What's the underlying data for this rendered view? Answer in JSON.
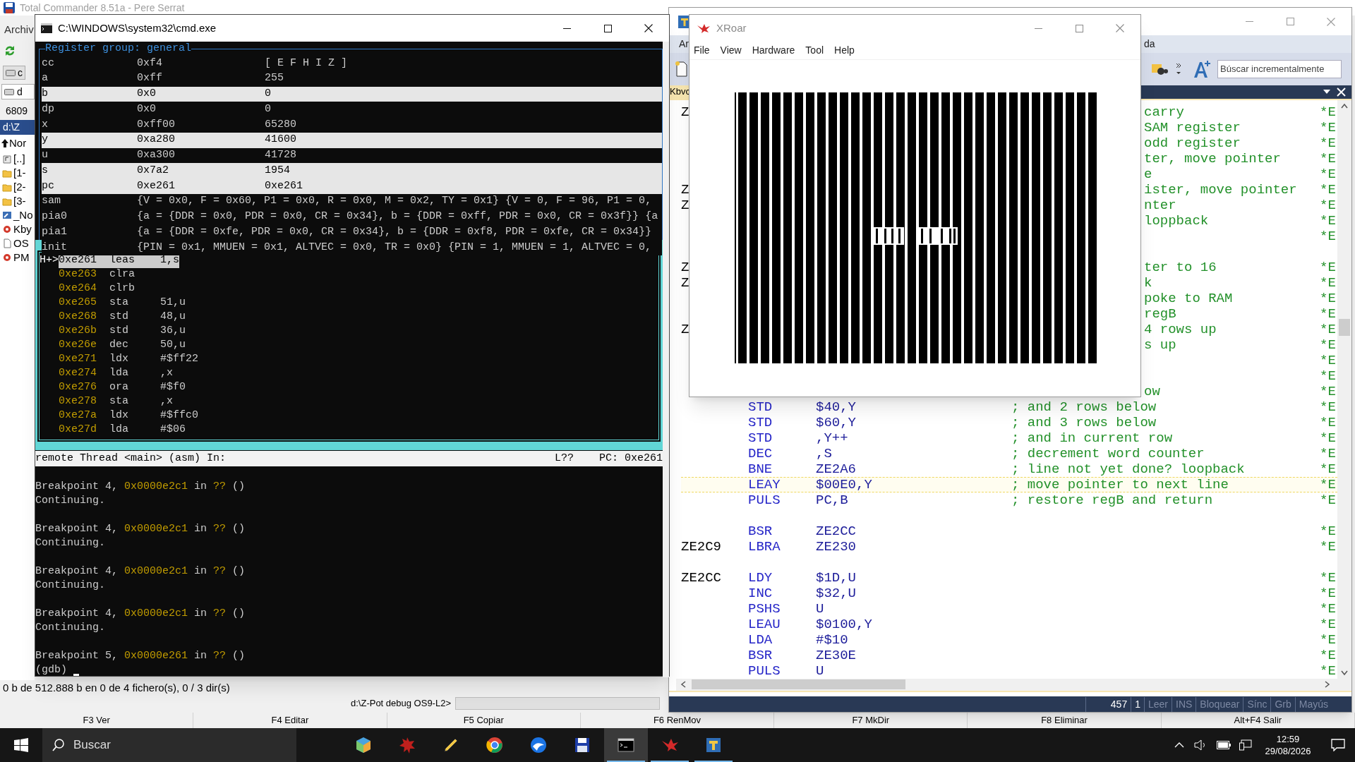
{
  "total_commander": {
    "title": "Total Commander 8.51a - Pere Serrat",
    "left_items": [
      {
        "kind": "menu",
        "text": "Archiv"
      },
      {
        "kind": "drive",
        "text": "c"
      },
      {
        "kind": "combo",
        "text": "d"
      },
      {
        "kind": "label",
        "text": "6809"
      },
      {
        "kind": "path",
        "text": "d:\\Z"
      },
      {
        "kind": "header",
        "text": "Nor"
      },
      {
        "kind": "parent",
        "text": "[..]"
      },
      {
        "kind": "folder",
        "text": "[1-"
      },
      {
        "kind": "folder",
        "text": "[2-"
      },
      {
        "kind": "folder",
        "text": "[3-"
      },
      {
        "kind": "shortcut",
        "text": "_No"
      },
      {
        "kind": "app",
        "text": "Kby"
      },
      {
        "kind": "file",
        "text": "OS"
      },
      {
        "kind": "app",
        "text": "PM"
      }
    ],
    "status": "0 b de 512.888 b en 0 de 4 fichero(s), 0 / 3 dir(s)",
    "command_prompt": "d:\\Z-Pot debug OS9-L2>",
    "function_keys": [
      "F3 Ver",
      "F4 Editar",
      "F5 Copiar",
      "F6 RenMov",
      "F7 MkDir",
      "F8 Eliminar",
      "Alt+F4 Salir"
    ]
  },
  "editor": {
    "menu_fragments": [
      "Ar",
      "da"
    ],
    "search": {
      "placeholder": "Búscar incrementalmente"
    },
    "tab": "Kbvc",
    "lines": [
      {
        "label": "Z",
        "fragment": "carry",
        "mark": "*E",
        "highlighted": false
      },
      {
        "fragment": "SAM register",
        "mark": "*E",
        "highlighted": false
      },
      {
        "fragment": "odd register",
        "mark": "*E",
        "highlighted": false
      },
      {
        "fragment": "ter, move pointer",
        "mark": "*E",
        "highlighted": false
      },
      {
        "fragment": "e",
        "mark": "*E",
        "highlighted": false
      },
      {
        "label": "Z",
        "fragment": "ister, move pointer",
        "mark": "*E",
        "highlighted": false
      },
      {
        "label": "Z",
        "fragment": "nter",
        "mark": "*E",
        "highlighted": false
      },
      {
        "fragment": "loppback",
        "mark": "*E",
        "highlighted": false
      },
      {
        "mark": "*E",
        "highlighted": false
      },
      {
        "highlighted": false
      },
      {
        "label": "Z",
        "fragment": "ter to 16",
        "mark": "*E",
        "highlighted": false
      },
      {
        "label": "Z",
        "fragment": "k",
        "mark": "*E",
        "highlighted": false
      },
      {
        "fragment": "poke to RAM",
        "mark": "*E",
        "highlighted": false
      },
      {
        "fragment": "regB",
        "mark": "*E",
        "highlighted": false
      },
      {
        "label": "Z",
        "fragment": "4 rows up",
        "mark": "*E",
        "highlighted": false
      },
      {
        "fragment": "s up",
        "mark": "*E",
        "highlighted": false
      },
      {
        "mark": "*E",
        "highlighted": false
      },
      {
        "mark": "*E",
        "highlighted": false
      },
      {
        "fragment": "ow",
        "mark": "*E",
        "highlighted": false
      },
      {
        "op": "STD",
        "operand": "$40,Y",
        "comment": "; and 2 rows below",
        "mark": "*E",
        "highlighted": false
      },
      {
        "op": "STD",
        "operand": "$60,Y",
        "comment": "; and 3 rows below",
        "mark": "*E",
        "highlighted": false
      },
      {
        "op": "STD",
        "operand": ",Y++",
        "comment": "; and in current row",
        "mark": "*E",
        "highlighted": false
      },
      {
        "op": "DEC",
        "operand": ",S",
        "comment": "; decrement word counter",
        "mark": "*E",
        "highlighted": false
      },
      {
        "op": "BNE",
        "operand": "ZE2A6",
        "comment": "; line not yet done? loopback",
        "mark": "*E",
        "highlighted": false
      },
      {
        "op": "LEAY",
        "operand": "$00E0,Y",
        "comment": "; move pointer to next line",
        "mark": "*E",
        "highlighted": true
      },
      {
        "op": "PULS",
        "operand": "PC,B",
        "comment": "; restore regB and return",
        "mark": "*E",
        "highlighted": false
      },
      {
        "highlighted": false
      },
      {
        "op": "BSR",
        "operand": "ZE2CC",
        "mark": "*E",
        "highlighted": false
      },
      {
        "label": "ZE2C9",
        "op": "LBRA",
        "operand": "ZE230",
        "mark": "*E",
        "highlighted": false
      },
      {
        "highlighted": false
      },
      {
        "label": "ZE2CC",
        "op": "LDY",
        "operand": "$1D,U",
        "mark": "*E",
        "highlighted": false
      },
      {
        "op": "INC",
        "operand": "$32,U",
        "mark": "*E",
        "highlighted": false
      },
      {
        "op": "PSHS",
        "operand": "U",
        "mark": "*E",
        "highlighted": false
      },
      {
        "op": "LEAU",
        "operand": "$0100,Y",
        "mark": "*E",
        "highlighted": false
      },
      {
        "op": "LDA",
        "operand": "#$10",
        "mark": "*E",
        "highlighted": false
      },
      {
        "op": "BSR",
        "operand": "ZE30E",
        "mark": "*E",
        "highlighted": false
      },
      {
        "op": "PULS",
        "operand": "U",
        "mark": "*E",
        "highlighted": false
      }
    ],
    "status_bar": [
      {
        "text": "457",
        "enabled": true
      },
      {
        "text": "1",
        "enabled": true
      },
      {
        "text": "Leer",
        "enabled": false
      },
      {
        "text": "INS",
        "enabled": false
      },
      {
        "text": "Bloquear",
        "enabled": false
      },
      {
        "text": "Sínc",
        "enabled": false
      },
      {
        "text": "Grb",
        "enabled": false
      },
      {
        "text": "Mayús",
        "enabled": false
      }
    ]
  },
  "console": {
    "title": "C:\\WINDOWS\\system32\\cmd.exe",
    "register_group": "Register group: general",
    "registers": [
      {
        "name": "cc",
        "hex": "0xf4",
        "natural": "[ E F H I Z ]",
        "changed": false
      },
      {
        "name": "a",
        "hex": "0xff",
        "natural": "255",
        "changed": false
      },
      {
        "name": "b",
        "hex": "0x0",
        "natural": "0",
        "changed": true
      },
      {
        "name": "dp",
        "hex": "0x0",
        "natural": "0",
        "changed": false
      },
      {
        "name": "x",
        "hex": "0xff00",
        "natural": "65280",
        "changed": false
      },
      {
        "name": "y",
        "hex": "0xa280",
        "natural": "41600",
        "changed": true
      },
      {
        "name": "u",
        "hex": "0xa300",
        "natural": "41728",
        "changed": false
      },
      {
        "name": "s",
        "hex": "0x7a2",
        "natural": "1954",
        "changed": true
      },
      {
        "name": "pc",
        "hex": "0xe261",
        "natural": "0xe261",
        "changed": true
      },
      {
        "name": "sam",
        "hex": "{V = 0x0, F = 0x60, P1 = 0x0, R = 0x0, M = 0x2, TY = 0x1}",
        "natural": "{V = 0, F = 96, P1 = 0,",
        "changed": false
      },
      {
        "name": "pia0",
        "hex": "{a = {DDR = 0x0, PDR = 0x0, CR = 0x34}, b = {DDR = 0xff, PDR = 0x0, CR = 0x3f}}",
        "natural": "{a",
        "changed": false
      },
      {
        "name": "pia1",
        "hex": "{a = {DDR = 0xfe, PDR = 0x0, CR = 0x34}, b = {DDR = 0xf8, PDR = 0xfe, CR = 0x34}}",
        "changed": false
      },
      {
        "name": "init",
        "hex": "{PIN = 0x1, MMUEN = 0x1, ALTVEC = 0x0, TR = 0x0}",
        "natural": "{PIN = 1, MMUEN = 1, ALTVEC = 0,",
        "changed": false
      }
    ],
    "disassembly": [
      {
        "marker": "H+>",
        "address": "0xe261",
        "mnemonic": "leas",
        "operand": "1,s",
        "current": true
      },
      {
        "address": "0xe263",
        "mnemonic": "clra",
        "current": false
      },
      {
        "address": "0xe264",
        "mnemonic": "clrb",
        "current": false
      },
      {
        "address": "0xe265",
        "mnemonic": "sta",
        "operand": "51,u",
        "current": false
      },
      {
        "address": "0xe268",
        "mnemonic": "std",
        "operand": "48,u",
        "current": false
      },
      {
        "address": "0xe26b",
        "mnemonic": "std",
        "operand": "36,u",
        "current": false
      },
      {
        "address": "0xe26e",
        "mnemonic": "dec",
        "operand": "50,u",
        "current": false
      },
      {
        "address": "0xe271",
        "mnemonic": "ldx",
        "operand": "#$ff22",
        "current": false
      },
      {
        "address": "0xe274",
        "mnemonic": "lda",
        "operand": ",x",
        "current": false
      },
      {
        "address": "0xe276",
        "mnemonic": "ora",
        "operand": "#$f0",
        "current": false
      },
      {
        "address": "0xe278",
        "mnemonic": "sta",
        "operand": ",x",
        "current": false
      },
      {
        "address": "0xe27a",
        "mnemonic": "ldx",
        "operand": "#$ffc0",
        "current": false
      },
      {
        "address": "0xe27d",
        "mnemonic": "lda",
        "operand": "#$06",
        "current": false
      }
    ],
    "status": {
      "thread": "remote Thread <main> (asm) In:",
      "line": "L??",
      "pc": "PC: 0xe261"
    },
    "log": [
      {
        "kind": "breakpoint",
        "text": "Breakpoint 4,",
        "address": "0x0000e2c1",
        "word": "in",
        "location": "??",
        "args": "()"
      },
      {
        "kind": "message",
        "text": "Continuing."
      },
      {
        "kind": "breakpoint",
        "text": "Breakpoint 4,",
        "address": "0x0000e2c1",
        "word": "in",
        "location": "??",
        "args": "()"
      },
      {
        "kind": "message",
        "text": "Continuing."
      },
      {
        "kind": "breakpoint",
        "text": "Breakpoint 4,",
        "address": "0x0000e2c1",
        "word": "in",
        "location": "??",
        "args": "()"
      },
      {
        "kind": "message",
        "text": "Continuing."
      },
      {
        "kind": "breakpoint",
        "text": "Breakpoint 4,",
        "address": "0x0000e2c1",
        "word": "in",
        "location": "??",
        "args": "()"
      },
      {
        "kind": "message",
        "text": "Continuing."
      },
      {
        "kind": "breakpoint",
        "text": "Breakpoint 5,",
        "address": "0x0000e261",
        "word": "in",
        "location": "??",
        "args": "()"
      }
    ],
    "prompt": "(gdb)"
  },
  "xroar": {
    "title": "XRoar",
    "menu": [
      "File",
      "View",
      "Hardware",
      "Tool",
      "Help"
    ]
  },
  "taskbar": {
    "search": {
      "placeholder": "Buscar"
    },
    "apps": [
      {
        "kind": "cube",
        "running": false,
        "selected": false
      },
      {
        "kind": "starburst",
        "running": false,
        "selected": false
      },
      {
        "kind": "pencil",
        "running": false,
        "selected": false
      },
      {
        "kind": "ring",
        "running": false,
        "selected": false
      },
      {
        "kind": "globe",
        "running": false,
        "selected": false
      },
      {
        "kind": "floppy",
        "running": false,
        "selected": false
      },
      {
        "kind": "terminal",
        "running": true,
        "selected": true
      },
      {
        "kind": "bird",
        "running": true,
        "selected": false
      },
      {
        "kind": "editor",
        "running": true,
        "selected": false
      }
    ],
    "time": "12:59",
    "date": "29/08/2026"
  }
}
